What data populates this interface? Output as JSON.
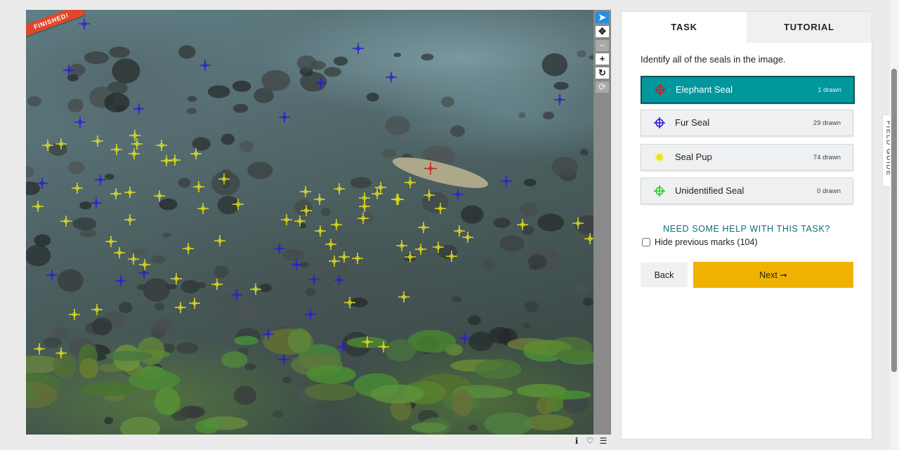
{
  "viewer": {
    "status_ribbon": "FINISHED!",
    "marker_colors": {
      "elephant": "#c81e1e",
      "fur": "#2b1bd6",
      "pup": "#e8e41a"
    }
  },
  "tools": [
    {
      "name": "annotate-tool",
      "icon": "pointer-icon",
      "glyph": "➤"
    },
    {
      "name": "move-tool",
      "icon": "move-arrows-icon",
      "glyph": "✥"
    },
    {
      "name": "zoom-out",
      "icon": "minus-icon",
      "glyph": "−"
    },
    {
      "name": "zoom-in",
      "icon": "plus-icon",
      "glyph": "+"
    },
    {
      "name": "rotate",
      "icon": "rotate-icon",
      "glyph": "↻"
    },
    {
      "name": "reset",
      "icon": "reset-icon",
      "glyph": "⟳"
    }
  ],
  "meta": {
    "info": "ℹ",
    "favorite": "♡",
    "collections": "☰"
  },
  "tabs": {
    "task": "TASK",
    "tutorial": "TUTORIAL"
  },
  "task": {
    "instruction": "Identify all of the seals in the image.",
    "answers": [
      {
        "label": "Elephant Seal",
        "count": "1 drawn",
        "color": "#c81e1e",
        "icon": "crosshair-icon"
      },
      {
        "label": "Fur Seal",
        "count": "29 drawn",
        "color": "#2b1bd6",
        "icon": "crosshair-icon"
      },
      {
        "label": "Seal Pup",
        "count": "74 drawn",
        "color": "#e8e41a",
        "icon": "dot-icon"
      },
      {
        "label": "Unidentified Seal",
        "count": "0 drawn",
        "color": "#2ec92e",
        "icon": "crosshair-icon"
      }
    ],
    "help_link": "NEED SOME HELP WITH THIS TASK?",
    "hide_marks_label": "Hide previous marks (104)",
    "back_label": "Back",
    "next_label": "Next ➞"
  },
  "field_guide_label": "FIELD GUIDE"
}
